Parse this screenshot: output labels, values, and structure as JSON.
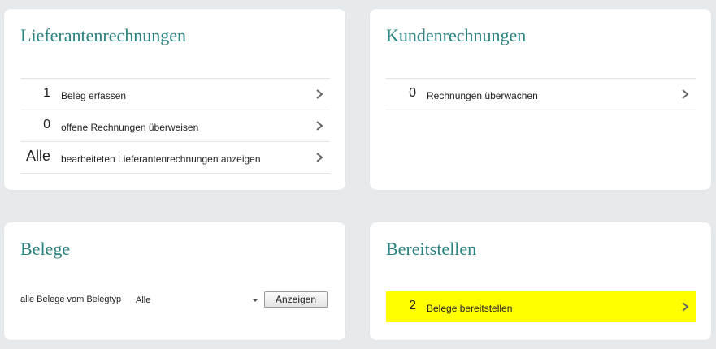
{
  "cards": {
    "lieferantenrechnungen": {
      "title": "Lieferantenrechnungen",
      "rows": [
        {
          "count": "1",
          "label": "Beleg erfassen"
        },
        {
          "count": "0",
          "label": "offene Rechnungen überweisen"
        },
        {
          "count": "Alle",
          "label": "bearbeiteten Lieferantenrechnungen anzeigen"
        }
      ]
    },
    "kundenrechnungen": {
      "title": "Kundenrechnungen",
      "rows": [
        {
          "count": "0",
          "label": "Rechnungen überwachen"
        }
      ]
    },
    "belege": {
      "title": "Belege",
      "filter_label": "alle Belege vom Belegtyp",
      "select_value": "Alle",
      "button_label": "Anzeigen"
    },
    "bereitstellen": {
      "title": "Bereitstellen",
      "rows": [
        {
          "count": "2",
          "label": "Belege bereitstellen",
          "highlight_color": "#ffff00"
        }
      ]
    }
  },
  "icons": {
    "row_action": "chevron-right-icon",
    "select_toggle": "caret-down-icon"
  },
  "colors": {
    "title": "#2a8281",
    "background": "#e7eaec",
    "card": "#ffffff",
    "highlight": "#ffff00"
  }
}
